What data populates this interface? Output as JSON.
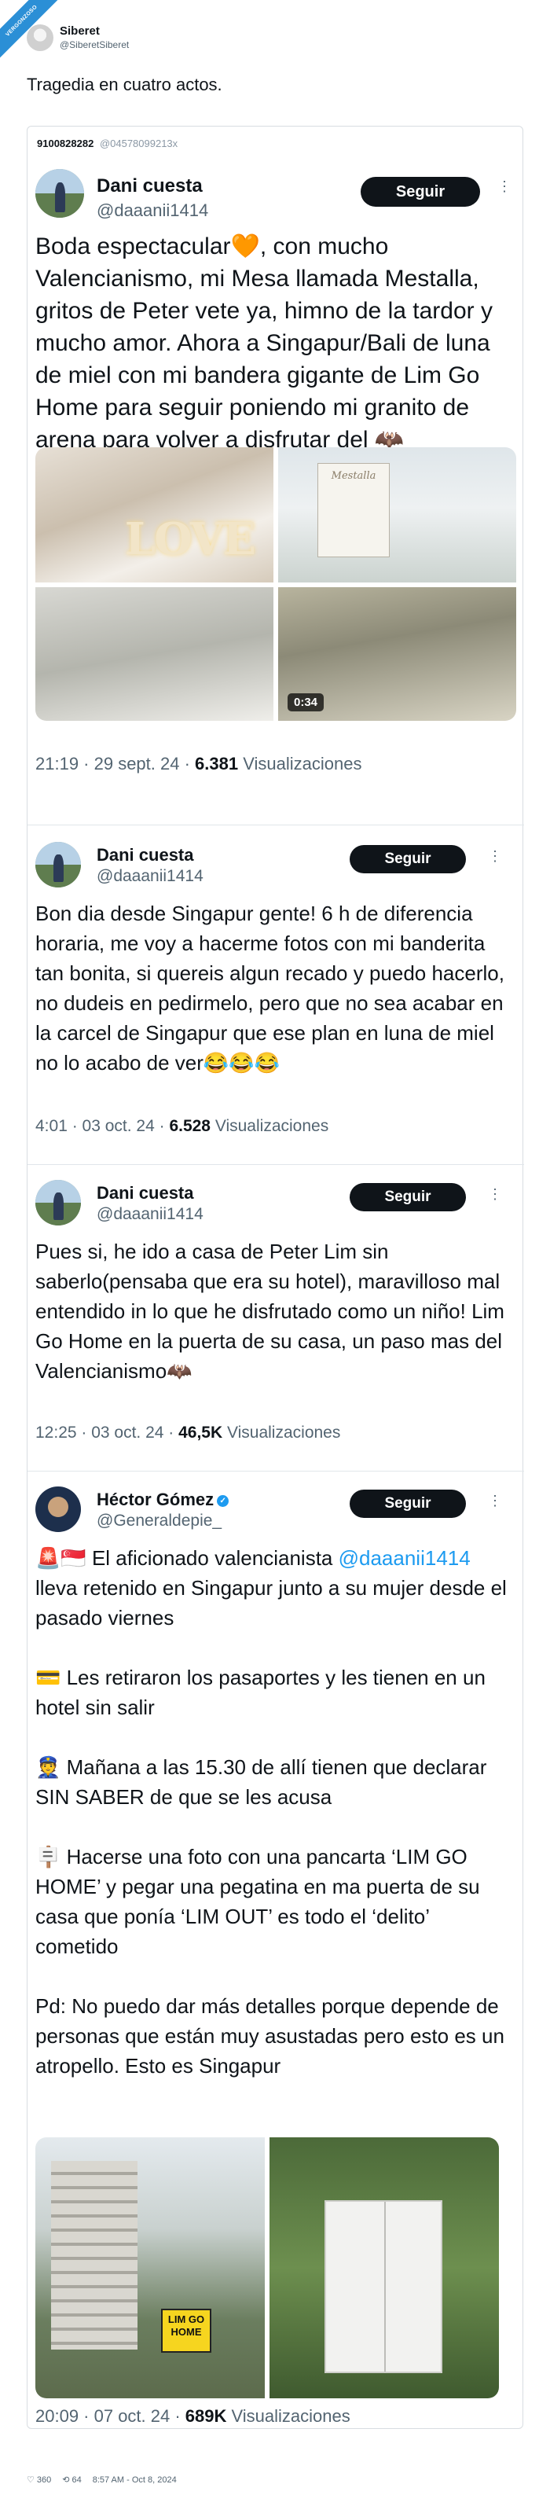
{
  "header": {
    "badge": "VERGONZOSO",
    "name": "Siberet",
    "handle": "@SiberetSiberet",
    "post_text": "Tragedia en cuatro actos."
  },
  "card": {
    "id": "9100828282",
    "id_secondary": "@04578099213x"
  },
  "tweets": [
    {
      "name": "Dani cuesta",
      "handle": "@daaanii1414",
      "follow": "Seguir",
      "text": "Boda espectacular🧡, con mucho Valencianismo, mi Mesa llamada Mestalla, gritos de Peter vete ya, himno de la tardor y mucho amor. Ahora a Singapur/Bali de luna de miel con mi bandera gigante de Lim Go Home para seguir poniendo mi granito de arena para volver a disfrutar del 🦇",
      "media": {
        "sign_text": "Mestalla",
        "love": "LOVE",
        "video_duration": "0:34"
      },
      "meta_time": "21:19 · 29 sept. 24 · ",
      "meta_views": "6.381",
      "meta_label": " Visualizaciones"
    },
    {
      "name": "Dani cuesta",
      "handle": "@daaanii1414",
      "follow": "Seguir",
      "text": "Bon dia desde Singapur gente! 6 h de diferencia horaria, me voy a hacerme fotos con mi banderita tan bonita, si quereis algun recado y puedo hacerlo, no dudeis en pedirmelo, pero que no sea acabar en la carcel de Singapur que ese plan en luna de miel no lo acabo de ver😂😂😂",
      "meta_time": "4:01 · 03 oct. 24 · ",
      "meta_views": "6.528",
      "meta_label": " Visualizaciones"
    },
    {
      "name": "Dani cuesta",
      "handle": "@daaanii1414",
      "follow": "Seguir",
      "text": "Pues si, he ido a casa de Peter Lim sin saberlo(pensaba que era su hotel), maravilloso mal entendido in lo que he disfrutado como un niño! Lim Go Home en la puerta de su casa, un paso mas del Valencianismo🦇",
      "meta_time": "12:25 · 03 oct. 24 · ",
      "meta_views": "46,5K",
      "meta_label": " Visualizaciones"
    },
    {
      "name": "Héctor Gómez",
      "handle": "@Generaldepie_",
      "follow": "Seguir",
      "text_p1_prefix": "🚨🇸🇬 El aficionado valencianista ",
      "text_p1_mention": "@daaanii1414",
      "text_p1_suffix": " lleva retenido en Singapur junto a su mujer desde el pasado viernes",
      "text_p2": "💳 Les retiraron los pasaportes y les tienen en un hotel sin salir",
      "text_p3": "👮 Mañana a las 15.30 de allí tienen que declarar SIN SABER de que se les acusa",
      "text_p4": "🪧 Hacerse una foto con una pancarta ‘LIM GO HOME’ y pegar una pegatina en ma puerta de su casa que ponía ‘LIM OUT’ es todo el ‘delito’ cometido",
      "text_p5": "Pd: No puedo dar más detalles porque depende de personas que están muy asustadas pero esto es un atropello. Esto es Singapur",
      "media": {
        "banner": "LIM GO HOME"
      },
      "meta_time": "20:09 · 07 oct. 24 · ",
      "meta_views": "689K",
      "meta_label": " Visualizaciones"
    }
  ],
  "footer": {
    "likes": "360",
    "retweets": "64",
    "timestamp": "8:57 AM - Oct 8, 2024"
  }
}
